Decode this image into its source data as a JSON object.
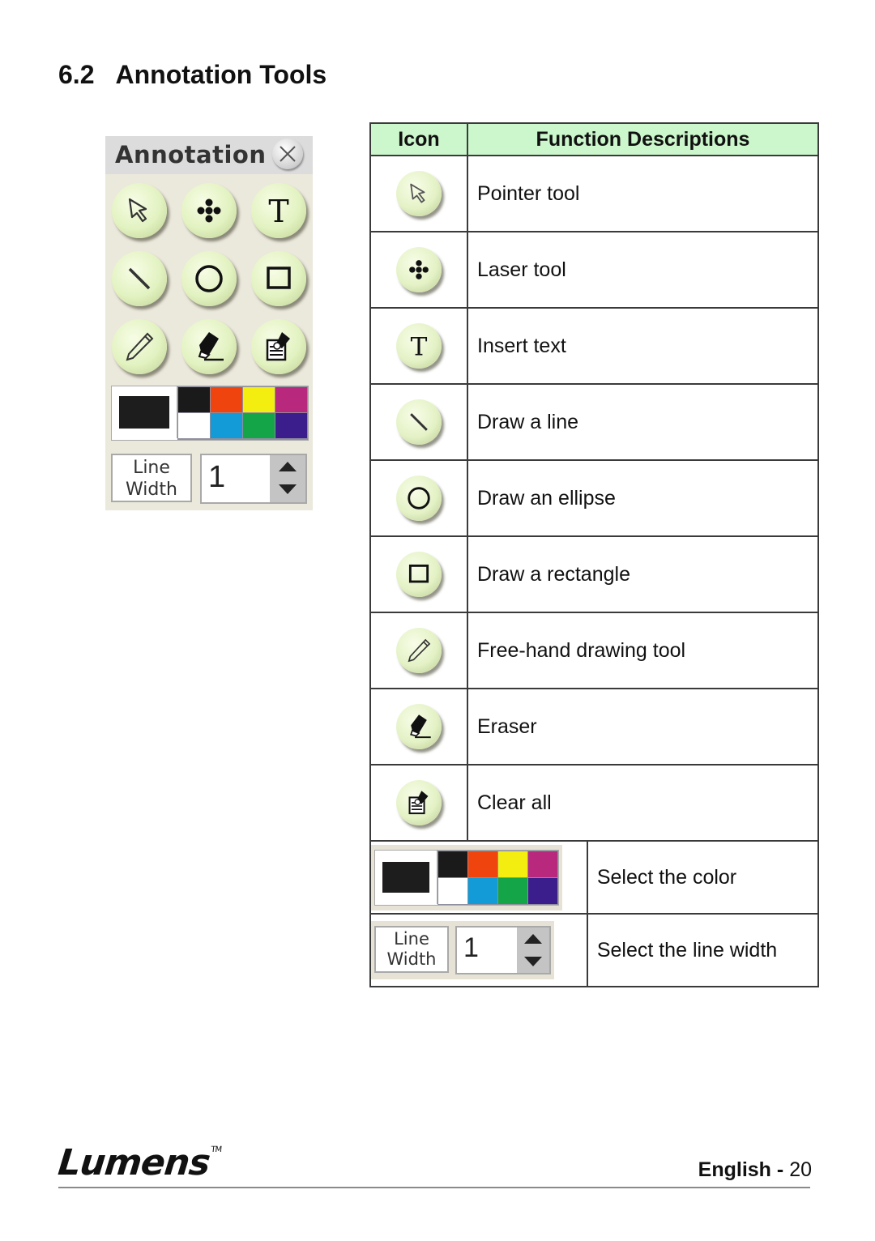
{
  "section": {
    "number": "6.2",
    "title": "Annotation Tools"
  },
  "panel": {
    "title": "Annotation",
    "close_icon": "close-icon",
    "tools": [
      {
        "icon": "pointer-icon",
        "label": "Pointer tool"
      },
      {
        "icon": "laser-icon",
        "label": "Laser tool"
      },
      {
        "icon": "text-icon",
        "label": "Insert text"
      },
      {
        "icon": "line-icon",
        "label": "Draw a line"
      },
      {
        "icon": "ellipse-icon",
        "label": "Draw an ellipse"
      },
      {
        "icon": "rectangle-icon",
        "label": "Draw a rectangle"
      },
      {
        "icon": "pencil-icon",
        "label": "Free-hand drawing tool"
      },
      {
        "icon": "eraser-icon",
        "label": "Eraser"
      },
      {
        "icon": "clear-all-icon",
        "label": "Clear all"
      }
    ],
    "current_color": "#1d1d1d",
    "palette": [
      "#1a1a1a",
      "#f0440e",
      "#f4ee10",
      "#b8287c",
      "#ffffff",
      "#129bd6",
      "#13a548",
      "#3b1d8c"
    ],
    "line_width_label_1": "Line",
    "line_width_label_2": "Width",
    "line_width_value": "1"
  },
  "table": {
    "headers": {
      "icon": "Icon",
      "description": "Function Descriptions"
    },
    "rows": [
      {
        "icon": "pointer-icon",
        "description": "Pointer tool"
      },
      {
        "icon": "laser-icon",
        "description": "Laser tool"
      },
      {
        "icon": "text-icon",
        "description": "Insert text"
      },
      {
        "icon": "line-icon",
        "description": "Draw a line"
      },
      {
        "icon": "ellipse-icon",
        "description": "Draw an ellipse"
      },
      {
        "icon": "rectangle-icon",
        "description": "Draw a rectangle"
      },
      {
        "icon": "pencil-icon",
        "description": "Free-hand drawing tool"
      },
      {
        "icon": "eraser-icon",
        "description": "Eraser"
      },
      {
        "icon": "clear-all-icon",
        "description": "Clear all"
      }
    ],
    "color_row": {
      "description": "Select the color"
    },
    "width_row": {
      "description": "Select the line width"
    }
  },
  "footer": {
    "brand": "Lumens",
    "trademark": "TM",
    "language": "English",
    "separator": "-",
    "page": "20"
  },
  "colors": {
    "header_bg": "#ccf7cc",
    "button_face": "#e2f2c0",
    "panel_bg": "#ebe8dc"
  }
}
